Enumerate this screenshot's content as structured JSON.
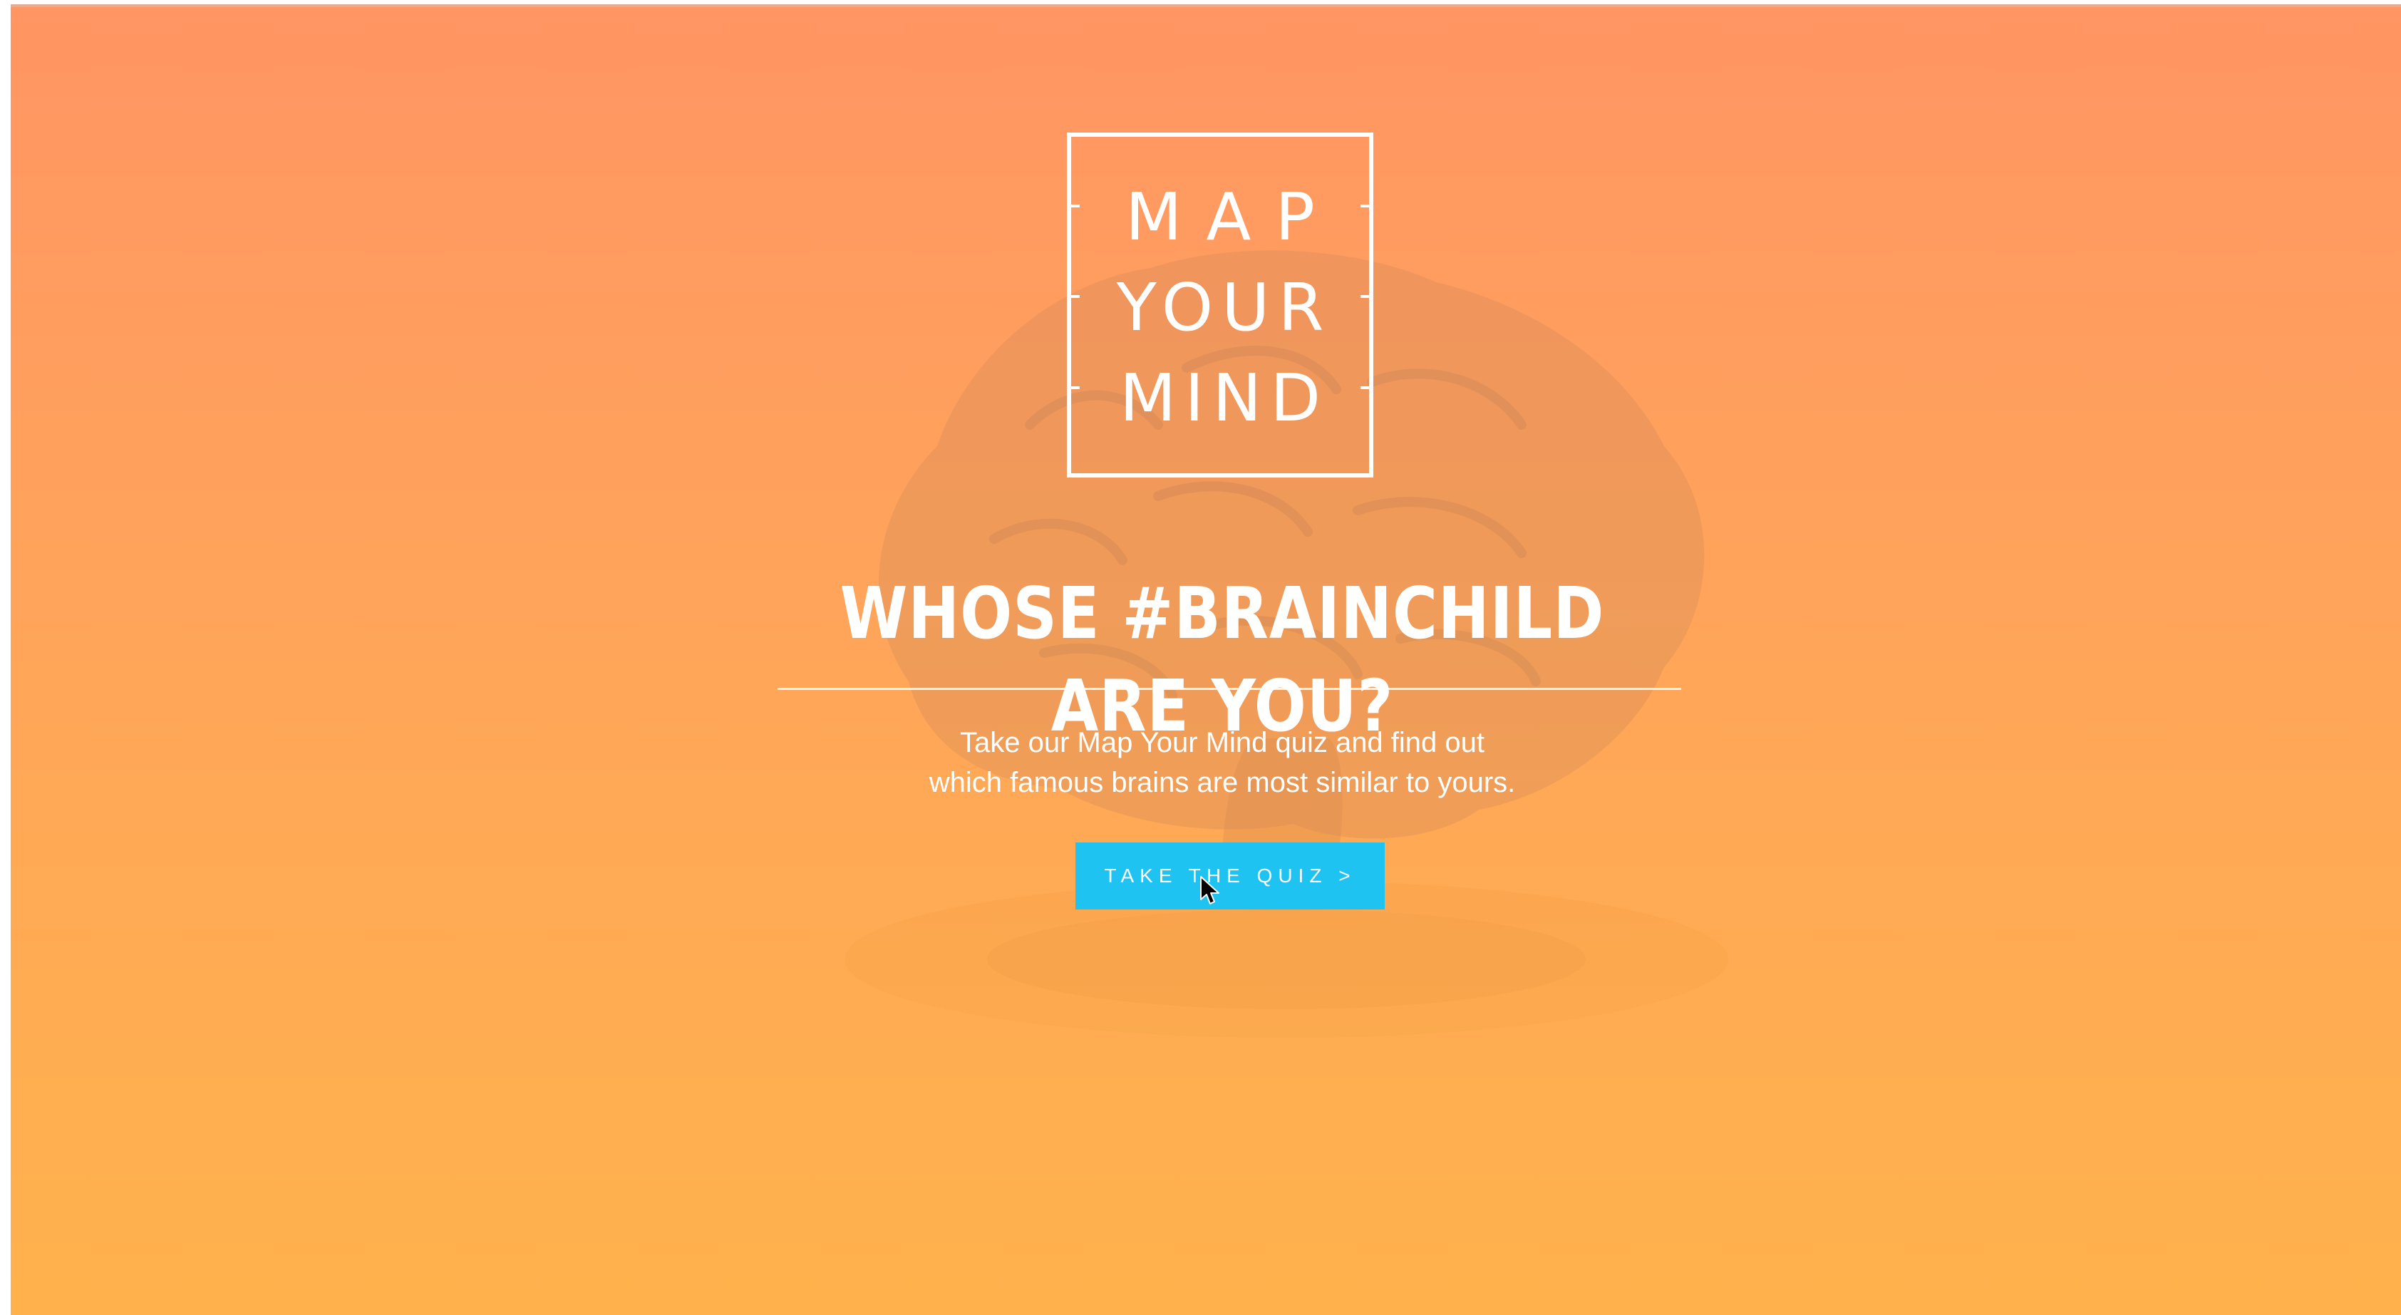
{
  "logo": {
    "line1": "MAP",
    "line2": "YOUR",
    "line3": "MIND"
  },
  "hero": {
    "headline": "WHOSE #BRAINCHILD ARE YOU?",
    "subtitle_line1": "Take our Map Your Mind quiz and find out",
    "subtitle_line2": "which famous brains are most similar to yours.",
    "cta_label": "TAKE THE QUIZ >"
  },
  "colors": {
    "gradient_top": "#ff9563",
    "gradient_bottom": "#ffb24c",
    "button": "#1fc3f2",
    "text": "#ffffff"
  },
  "icons": {
    "cursor": "arrow-cursor-icon",
    "background": "brain-image"
  }
}
